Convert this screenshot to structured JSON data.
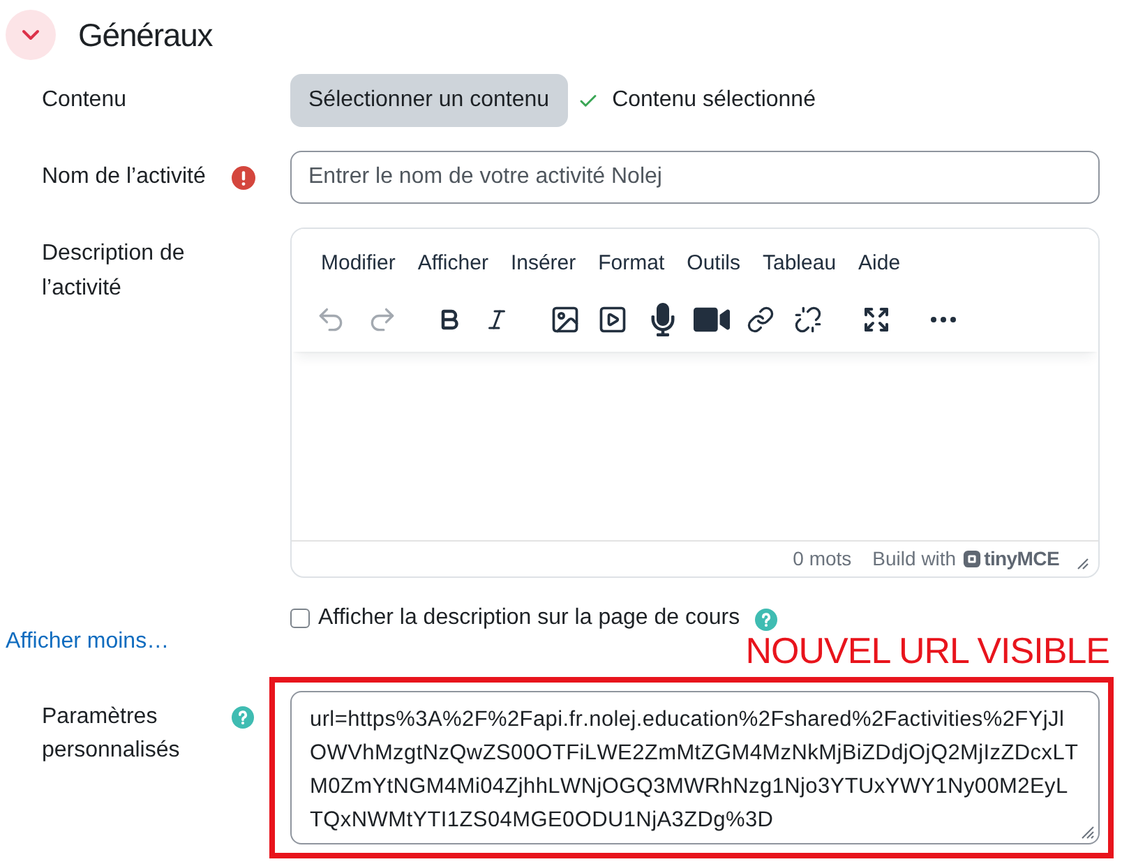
{
  "section": {
    "title": "Généraux",
    "expanded": true
  },
  "content_field": {
    "label": "Contenu",
    "button": "Sélectionner un contenu",
    "status": "Contenu sélectionné"
  },
  "name_field": {
    "label": "Nom de l’activité",
    "required": true,
    "placeholder": "Entrer le nom de votre activité Nolej"
  },
  "description_field": {
    "label": "Description de l’activité",
    "editor": {
      "menu": [
        "Modifier",
        "Afficher",
        "Insérer",
        "Format",
        "Outils",
        "Tableau",
        "Aide"
      ],
      "toolbar": [
        {
          "disabled": true
        },
        {
          "disabled": true
        },
        {
          "disabled": false
        },
        {
          "disabled": false
        },
        {
          "disabled": false
        },
        {
          "disabled": false
        },
        {
          "disabled": false
        },
        {
          "disabled": false
        },
        {
          "disabled": false
        },
        {
          "disabled": false
        },
        {
          "disabled": false
        },
        {
          "disabled": false
        }
      ],
      "word_count": "0 mots",
      "branding": {
        "prefix": "Build with",
        "brand": "tinyMCE"
      }
    }
  },
  "show_description": {
    "label": "Afficher la description sur la page de cours",
    "checked": false,
    "help": true
  },
  "toggle_link": "Afficher moins…",
  "custom_params": {
    "label": "Paramètres personnalisés",
    "help": true,
    "value": "url=https%3A%2F%2Fapi.fr.nolej.education%2Fshared%2Factivities%2FYjJlOWVhMzgtNzQwZS00OTFiLWE2ZmMtZGM4MzNkMjBiZDdjOjQ2MjIzZDcxLTM0ZmYtNGM4Mi04ZjhhLWNjOGQ3MWRhNzg1Njo3YTUxYWY1Ny00M2EyLTQxNWMtYTI1ZS04MGE0ODU1NjA3ZDg%3D"
  },
  "annotation": {
    "text": "NOUVEL URL VISIBLE"
  }
}
